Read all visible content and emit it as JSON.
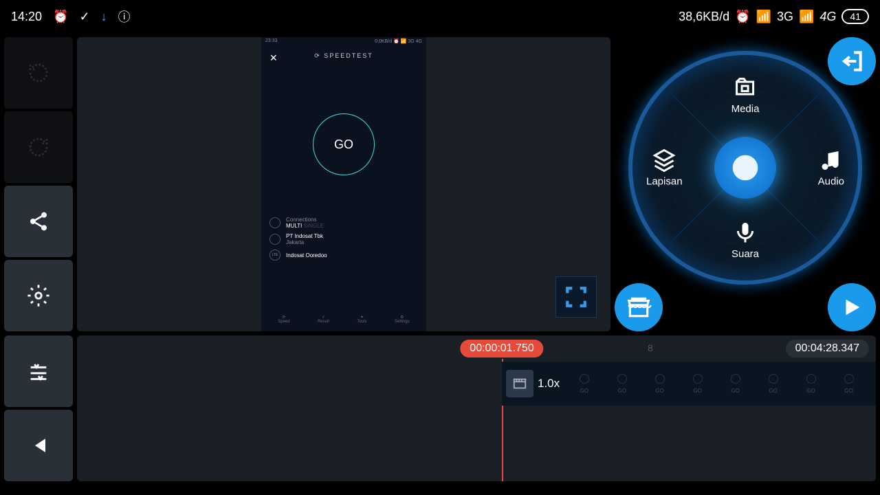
{
  "statusBar": {
    "time": "14:20",
    "netSpeed": "38,6KB/d",
    "net1": "3G",
    "net2": "4G",
    "battery": "41"
  },
  "preview": {
    "phoneTime": "23:33",
    "phoneNet": "0,0KB/d",
    "phoneSignal": "3G  4G",
    "title": "SPEEDTEST",
    "go": "GO",
    "connLabel": "Connections",
    "connValue": "MULTI",
    "connAlt": "SINGLE",
    "isp": "PT Indosat Tbk",
    "ispCity": "Jakarta",
    "server": "Indosat Ooredoo",
    "tabs": [
      "Speed",
      "Result",
      "Tools",
      "Settings"
    ]
  },
  "wheel": {
    "top": "Media",
    "left": "Lapisan",
    "right": "Audio",
    "bottom": "Suara"
  },
  "timeline": {
    "current": "00:00:01.750",
    "total": "00:04:28.347",
    "tick1": "8",
    "clipSpeed": "1.0x",
    "thumbLabel": "GO"
  }
}
